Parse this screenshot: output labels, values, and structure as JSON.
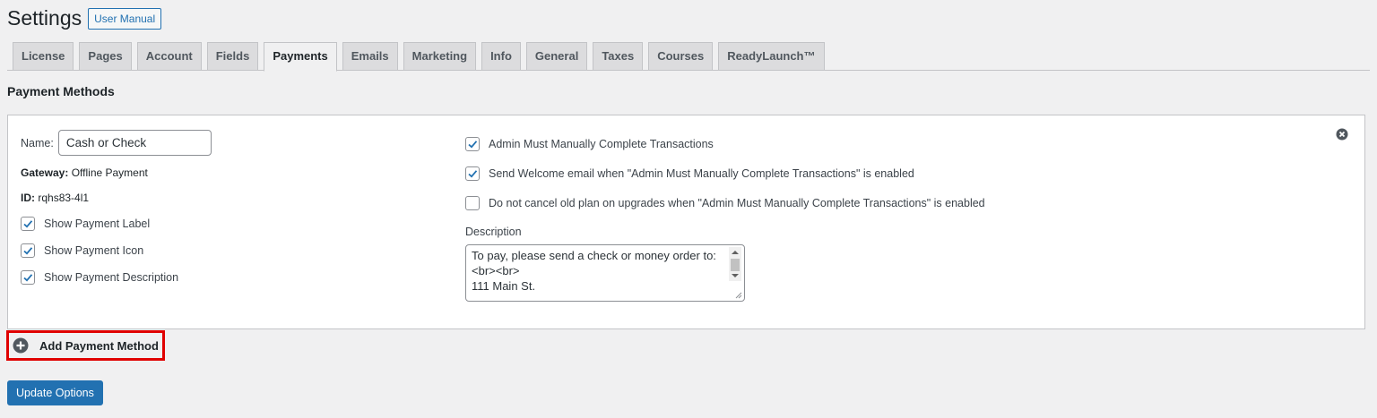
{
  "header": {
    "title": "Settings",
    "manual_label": "User Manual"
  },
  "tabs": [
    {
      "label": "License",
      "active": false
    },
    {
      "label": "Pages",
      "active": false
    },
    {
      "label": "Account",
      "active": false
    },
    {
      "label": "Fields",
      "active": false
    },
    {
      "label": "Payments",
      "active": true
    },
    {
      "label": "Emails",
      "active": false
    },
    {
      "label": "Marketing",
      "active": false
    },
    {
      "label": "Info",
      "active": false
    },
    {
      "label": "General",
      "active": false
    },
    {
      "label": "Taxes",
      "active": false
    },
    {
      "label": "Courses",
      "active": false
    },
    {
      "label": "ReadyLaunch™",
      "active": false
    }
  ],
  "section_title": "Payment Methods",
  "method": {
    "name_label": "Name:",
    "name_value": "Cash or Check",
    "gateway_label": "Gateway:",
    "gateway_value": "Offline Payment",
    "id_label": "ID:",
    "id_value": "rqhs83-4l1",
    "left_options": [
      {
        "label": "Show Payment Label",
        "checked": true
      },
      {
        "label": "Show Payment Icon",
        "checked": true
      },
      {
        "label": "Show Payment Description",
        "checked": true
      }
    ],
    "right_options": [
      {
        "label": "Admin Must Manually Complete Transactions",
        "checked": true
      },
      {
        "label": "Send Welcome email when \"Admin Must Manually Complete Transactions\" is enabled",
        "checked": true
      },
      {
        "label": "Do not cancel old plan on upgrades when \"Admin Must Manually Complete Transactions\" is enabled",
        "checked": false
      }
    ],
    "description_label": "Description",
    "description_lines": [
      "To pay, please send a check or money order to:",
      "<br><br>",
      "111 Main St."
    ]
  },
  "add_label": "Add Payment Method",
  "update_label": "Update Options",
  "colors": {
    "primary": "#2271b1",
    "highlight": "#e00000",
    "panel_border": "#c3c4c7"
  },
  "icons": {
    "close": "close-circle-icon",
    "add": "plus-circle-icon",
    "check": "checkmark-icon"
  }
}
